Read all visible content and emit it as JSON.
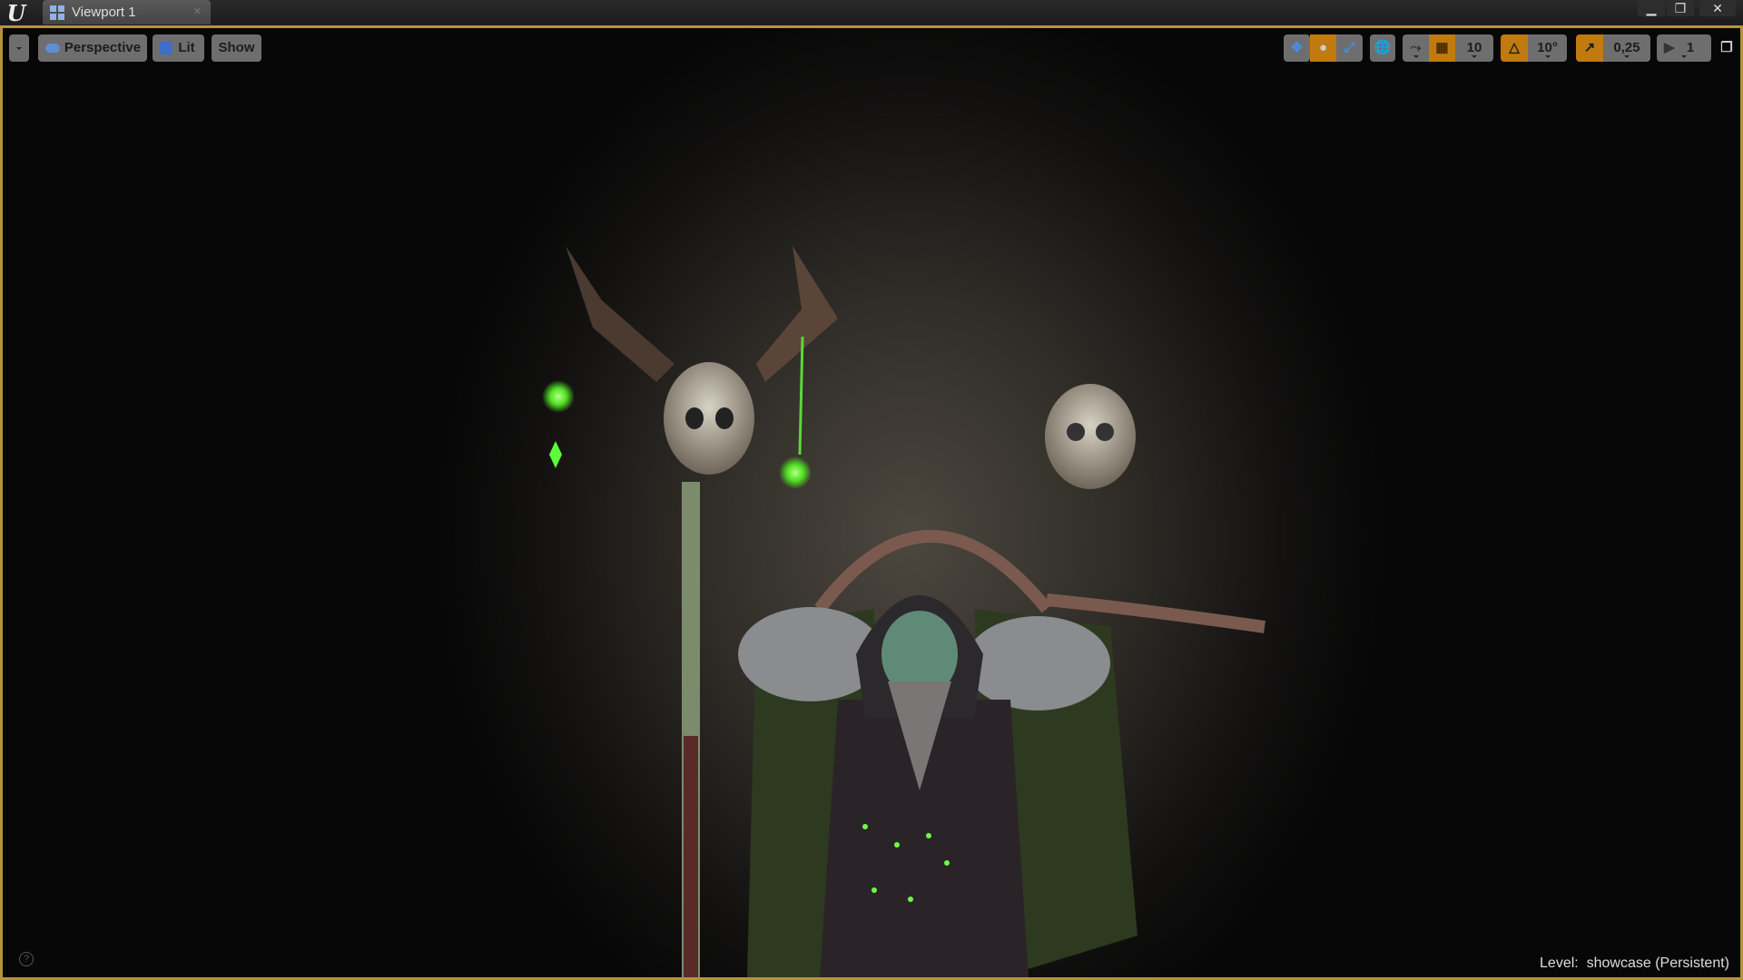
{
  "window": {
    "tab_title": "Viewport 1",
    "logo": "U"
  },
  "toolbar": {
    "perspective_label": "Perspective",
    "lit_label": "Lit",
    "show_label": "Show",
    "grid_snap_value": "10",
    "rotation_snap_value": "10°",
    "scale_snap_value": "0,25",
    "camera_speed_value": "1"
  },
  "status": {
    "level_label": "Level:",
    "level_name": "showcase (Persistent)",
    "help": "?"
  },
  "colors": {
    "border": "#b8923a",
    "active_snap": "#c07a10",
    "glow": "#5dff3a"
  }
}
